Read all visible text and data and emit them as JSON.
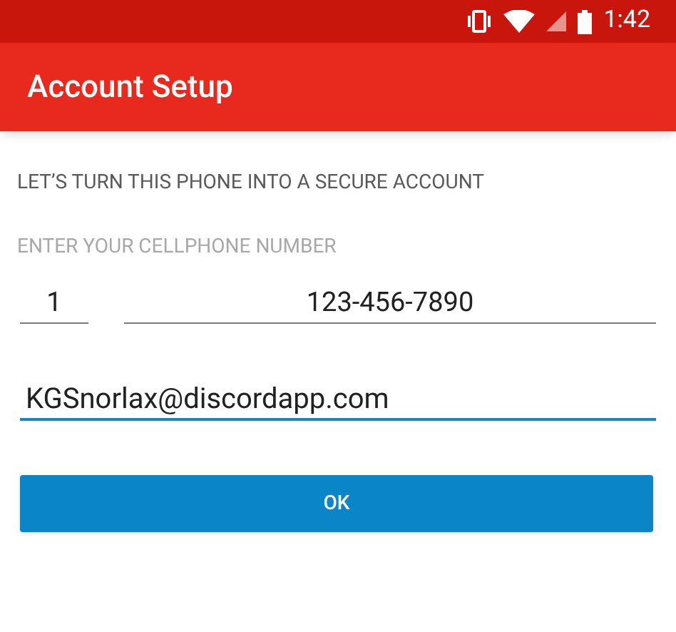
{
  "status_bar": {
    "time": "1:42"
  },
  "app_bar": {
    "title": "Account Setup"
  },
  "intro": "LET’S TURN THIS PHONE INTO A SECURE ACCOUNT",
  "phone_label": "ENTER YOUR CELLPHONE NUMBER",
  "fields": [
    {
      "kind": "country_code",
      "value": "1",
      "focused": false
    },
    {
      "kind": "phone",
      "value": "123-456-7890",
      "focused": false
    },
    {
      "kind": "email",
      "value": "KGSnorlax@discordapp.com",
      "focused": true
    }
  ],
  "button": {
    "label": "OK"
  }
}
